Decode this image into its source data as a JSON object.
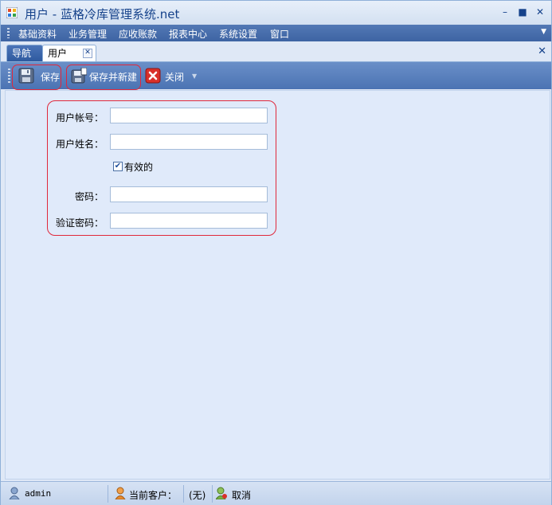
{
  "window": {
    "title": "用户 - 蓝格冷库管理系统.net",
    "minimize_glyph": "–",
    "restore_glyph": "■",
    "close_glyph": "✕",
    "app_icon": "app-window-icon"
  },
  "menu": {
    "items": [
      "基础资料",
      "业务管理",
      "应收账款",
      "报表中心",
      "系统设置",
      "窗口"
    ],
    "overflow_glyph": "▼"
  },
  "tabs": {
    "items": [
      {
        "label": "导航",
        "active": false
      },
      {
        "label": "用户",
        "active": true,
        "close_glyph": "✕"
      }
    ],
    "strip_close_glyph": "✕"
  },
  "toolbar": {
    "save_label": "保存",
    "save_new_label": "保存并新建",
    "close_label": "关闭",
    "dropdown_glyph": "▼",
    "icons": [
      "floppy-disk-icon",
      "save-new-icon",
      "red-x-close-icon"
    ],
    "highlight_color": "#e0283b"
  },
  "form": {
    "account_label": "用户帐号：",
    "account_value": "",
    "name_label": "用户姓名：",
    "name_value": "",
    "active_label": "有效的",
    "active_checked": true,
    "check_glyph": "✔",
    "password_label": "密码：",
    "password_value": "",
    "confirm_label": "验证密码：",
    "confirm_value": ""
  },
  "status": {
    "user": "admin",
    "customer_label": "当前客户：",
    "customer_value": "(无)",
    "cancel_label": "取消"
  },
  "colors": {
    "menu_bg": "#3e64a3",
    "toolbar_bg": "#4b73b3",
    "content_bg": "#e0eafa",
    "title_text": "#15428b"
  }
}
